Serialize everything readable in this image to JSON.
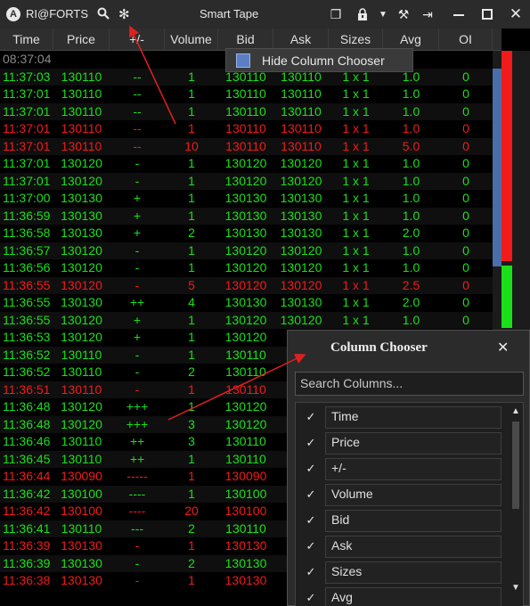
{
  "titlebar": {
    "logo": "A",
    "symbol": "RI@FORTS",
    "title": "Smart Tape",
    "icons": [
      "search-icon",
      "freeze-icon",
      "window-icon",
      "lock-icon",
      "dropdown-icon",
      "tools-icon",
      "pin-icon",
      "minimize-icon",
      "maximize-icon",
      "close-icon"
    ]
  },
  "columns": [
    "Time",
    "Price",
    "+/-",
    "Volume",
    "Bid",
    "Ask",
    "Sizes",
    "Avg",
    "OI"
  ],
  "context_menu": {
    "label": "Hide Column Chooser"
  },
  "trades": [
    {
      "time": "08:37:04",
      "price": "",
      "change": "",
      "volume": "",
      "bid": "",
      "ask": "",
      "sizes": "",
      "avg": "",
      "oi": "",
      "color": "gray"
    },
    {
      "time": "11:37:03",
      "price": "130110",
      "change": "--",
      "volume": "1",
      "bid": "130110",
      "ask": "130110",
      "sizes": "1 x 1",
      "avg": "1.0",
      "oi": "0",
      "color": "green"
    },
    {
      "time": "11:37:01",
      "price": "130110",
      "change": "--",
      "volume": "1",
      "bid": "130110",
      "ask": "130110",
      "sizes": "1 x 1",
      "avg": "1.0",
      "oi": "0",
      "color": "green"
    },
    {
      "time": "11:37:01",
      "price": "130110",
      "change": "--",
      "volume": "1",
      "bid": "130110",
      "ask": "130110",
      "sizes": "1 x 1",
      "avg": "1.0",
      "oi": "0",
      "color": "green"
    },
    {
      "time": "11:37:01",
      "price": "130110",
      "change": "--",
      "volume": "1",
      "bid": "130110",
      "ask": "130110",
      "sizes": "1 x 1",
      "avg": "1.0",
      "oi": "0",
      "color": "red"
    },
    {
      "time": "11:37:01",
      "price": "130110",
      "change": "--",
      "volume": "10",
      "bid": "130110",
      "ask": "130110",
      "sizes": "1 x 1",
      "avg": "5.0",
      "oi": "0",
      "color": "red"
    },
    {
      "time": "11:37:01",
      "price": "130120",
      "change": "-",
      "volume": "1",
      "bid": "130120",
      "ask": "130120",
      "sizes": "1 x 1",
      "avg": "1.0",
      "oi": "0",
      "color": "green"
    },
    {
      "time": "11:37:01",
      "price": "130120",
      "change": "-",
      "volume": "1",
      "bid": "130120",
      "ask": "130120",
      "sizes": "1 x 1",
      "avg": "1.0",
      "oi": "0",
      "color": "green"
    },
    {
      "time": "11:37:00",
      "price": "130130",
      "change": "+",
      "volume": "1",
      "bid": "130130",
      "ask": "130130",
      "sizes": "1 x 1",
      "avg": "1.0",
      "oi": "0",
      "color": "green"
    },
    {
      "time": "11:36:59",
      "price": "130130",
      "change": "+",
      "volume": "1",
      "bid": "130130",
      "ask": "130130",
      "sizes": "1 x 1",
      "avg": "1.0",
      "oi": "0",
      "color": "green"
    },
    {
      "time": "11:36:58",
      "price": "130130",
      "change": "+",
      "volume": "2",
      "bid": "130130",
      "ask": "130130",
      "sizes": "1 x 1",
      "avg": "2.0",
      "oi": "0",
      "color": "green"
    },
    {
      "time": "11:36:57",
      "price": "130120",
      "change": "-",
      "volume": "1",
      "bid": "130120",
      "ask": "130120",
      "sizes": "1 x 1",
      "avg": "1.0",
      "oi": "0",
      "color": "green"
    },
    {
      "time": "11:36:56",
      "price": "130120",
      "change": "-",
      "volume": "1",
      "bid": "130120",
      "ask": "130120",
      "sizes": "1 x 1",
      "avg": "1.0",
      "oi": "0",
      "color": "green"
    },
    {
      "time": "11:36:55",
      "price": "130120",
      "change": "-",
      "volume": "5",
      "bid": "130120",
      "ask": "130120",
      "sizes": "1 x 1",
      "avg": "2.5",
      "oi": "0",
      "color": "red"
    },
    {
      "time": "11:36:55",
      "price": "130130",
      "change": "++",
      "volume": "4",
      "bid": "130130",
      "ask": "130130",
      "sizes": "1 x 1",
      "avg": "2.0",
      "oi": "0",
      "color": "green"
    },
    {
      "time": "11:36:55",
      "price": "130120",
      "change": "+",
      "volume": "1",
      "bid": "130120",
      "ask": "130120",
      "sizes": "1 x 1",
      "avg": "1.0",
      "oi": "0",
      "color": "green"
    },
    {
      "time": "11:36:53",
      "price": "130120",
      "change": "+",
      "volume": "1",
      "bid": "130120",
      "ask": "",
      "sizes": "",
      "avg": "",
      "oi": "",
      "color": "green"
    },
    {
      "time": "11:36:52",
      "price": "130110",
      "change": "-",
      "volume": "1",
      "bid": "130110",
      "ask": "",
      "sizes": "",
      "avg": "",
      "oi": "",
      "color": "green"
    },
    {
      "time": "11:36:52",
      "price": "130110",
      "change": "-",
      "volume": "2",
      "bid": "130110",
      "ask": "",
      "sizes": "",
      "avg": "",
      "oi": "",
      "color": "green"
    },
    {
      "time": "11:36:51",
      "price": "130110",
      "change": "-",
      "volume": "1",
      "bid": "130110",
      "ask": "",
      "sizes": "",
      "avg": "",
      "oi": "",
      "color": "red"
    },
    {
      "time": "11:36:48",
      "price": "130120",
      "change": "+++",
      "volume": "1",
      "bid": "130120",
      "ask": "",
      "sizes": "",
      "avg": "",
      "oi": "",
      "color": "green"
    },
    {
      "time": "11:36:48",
      "price": "130120",
      "change": "+++",
      "volume": "3",
      "bid": "130120",
      "ask": "",
      "sizes": "",
      "avg": "",
      "oi": "",
      "color": "green"
    },
    {
      "time": "11:36:46",
      "price": "130110",
      "change": "++",
      "volume": "3",
      "bid": "130110",
      "ask": "",
      "sizes": "",
      "avg": "",
      "oi": "",
      "color": "green"
    },
    {
      "time": "11:36:45",
      "price": "130110",
      "change": "++",
      "volume": "1",
      "bid": "130110",
      "ask": "",
      "sizes": "",
      "avg": "",
      "oi": "",
      "color": "green"
    },
    {
      "time": "11:36:44",
      "price": "130090",
      "change": "-----",
      "volume": "1",
      "bid": "130090",
      "ask": "",
      "sizes": "",
      "avg": "",
      "oi": "",
      "color": "red"
    },
    {
      "time": "11:36:42",
      "price": "130100",
      "change": "----",
      "volume": "1",
      "bid": "130100",
      "ask": "",
      "sizes": "",
      "avg": "",
      "oi": "",
      "color": "green"
    },
    {
      "time": "11:36:42",
      "price": "130100",
      "change": "----",
      "volume": "20",
      "bid": "130100",
      "ask": "",
      "sizes": "",
      "avg": "",
      "oi": "",
      "color": "red"
    },
    {
      "time": "11:36:41",
      "price": "130110",
      "change": "---",
      "volume": "2",
      "bid": "130110",
      "ask": "",
      "sizes": "",
      "avg": "",
      "oi": "",
      "color": "green"
    },
    {
      "time": "11:36:39",
      "price": "130130",
      "change": "-",
      "volume": "1",
      "bid": "130130",
      "ask": "",
      "sizes": "",
      "avg": "",
      "oi": "",
      "color": "red"
    },
    {
      "time": "11:36:39",
      "price": "130130",
      "change": "-",
      "volume": "2",
      "bid": "130130",
      "ask": "",
      "sizes": "",
      "avg": "",
      "oi": "",
      "color": "green"
    },
    {
      "time": "11:36:38",
      "price": "130130",
      "change": "-",
      "volume": "1",
      "bid": "130130",
      "ask": "",
      "sizes": "",
      "avg": "",
      "oi": "",
      "color": "red"
    }
  ],
  "column_chooser": {
    "title": "Column Chooser",
    "search_placeholder": "Search Columns...",
    "items": [
      {
        "label": "Time",
        "checked": true
      },
      {
        "label": "Price",
        "checked": true
      },
      {
        "label": "+/-",
        "checked": true
      },
      {
        "label": "Volume",
        "checked": true
      },
      {
        "label": "Bid",
        "checked": true
      },
      {
        "label": "Ask",
        "checked": true
      },
      {
        "label": "Sizes",
        "checked": true
      },
      {
        "label": "Avg",
        "checked": true
      }
    ]
  },
  "colors": {
    "buy": "#19e019",
    "sell": "#f21a1a",
    "annotation": "#e02020",
    "scroll_thumb": "#4a6ea8"
  }
}
